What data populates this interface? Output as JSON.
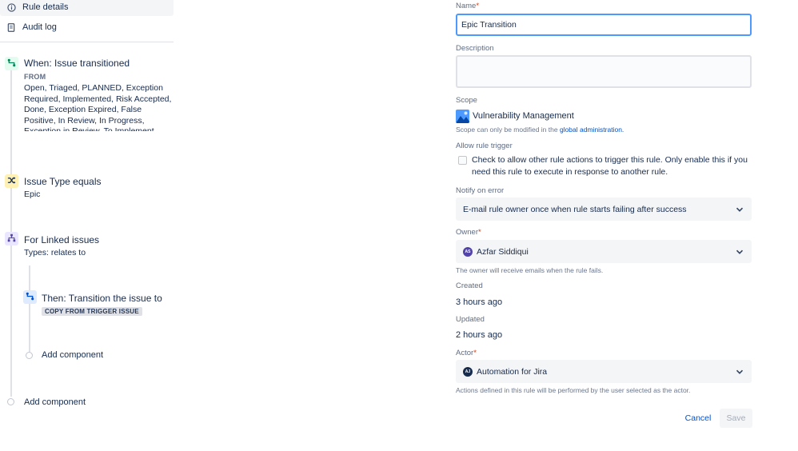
{
  "nav": {
    "rule_details": "Rule details",
    "audit_log": "Audit log"
  },
  "trigger": {
    "title": "When: Issue transitioned",
    "from_label": "FROM",
    "from_statuses": "Open, Triaged, PLANNED, Exception Required, Implemented, Risk Accepted, Done, Exception Expired, False Positive, In Review, In Progress, Exception in Review, To Implement, Backlog,"
  },
  "condition": {
    "title": "Issue Type equals",
    "value": "Epic"
  },
  "branch": {
    "title": "For Linked issues",
    "types": "Types: relates to"
  },
  "action": {
    "title": "Then: Transition the issue to",
    "badge": "COPY FROM TRIGGER ISSUE"
  },
  "add_component_inner": "Add component",
  "add_component_outer": "Add component",
  "form": {
    "name_label": "Name",
    "name_value": "Epic Transition",
    "required_mark": "*",
    "description_label": "Description",
    "description_value": "",
    "scope_label": "Scope",
    "scope_value": "Vulnerability Management",
    "scope_help": "Scope can only be modified in the",
    "scope_help_link": "global administration.",
    "allow_trigger_label": "Allow rule trigger",
    "allow_trigger_text": "Check to allow other rule actions to trigger this rule. Only enable this if you need this rule to execute in response to another rule.",
    "allow_trigger_checked": false,
    "notify_label": "Notify on error",
    "notify_value": "E-mail rule owner once when rule starts failing after success",
    "owner_label": "Owner",
    "owner_initials": "AS",
    "owner_name": "Azfar Siddiqui",
    "owner_help": "The owner will receive emails when the rule fails.",
    "created_label": "Created",
    "created_value": "3 hours ago",
    "updated_label": "Updated",
    "updated_value": "2 hours ago",
    "actor_label": "Actor",
    "actor_initials": "AJ",
    "actor_name": "Automation for Jira",
    "actor_help": "Actions defined in this rule will be performed by the user selected as the actor.",
    "cancel_label": "Cancel",
    "save_label": "Save"
  },
  "colors": {
    "trigger_tile": "#e3fcef",
    "trigger_icon": "#00875a",
    "condition_tile": "#fff0b3",
    "condition_icon": "#172b4d",
    "branch_tile": "#eae6ff",
    "branch_icon": "#5243aa",
    "action_tile": "#deebff",
    "action_icon": "#0052cc",
    "owner_avatar": "#5243aa",
    "actor_avatar": "#172b4d",
    "link": "#0052cc",
    "focus_border": "#4c9aff"
  },
  "icons": {
    "rule_details": "info-icon",
    "audit_log": "audit-log-icon",
    "trigger": "transition-icon",
    "condition": "shuffle-icon",
    "branch": "branch-icon",
    "action": "transition-icon",
    "scope": "project-avatar-icon",
    "select": "chevron-down-icon"
  }
}
